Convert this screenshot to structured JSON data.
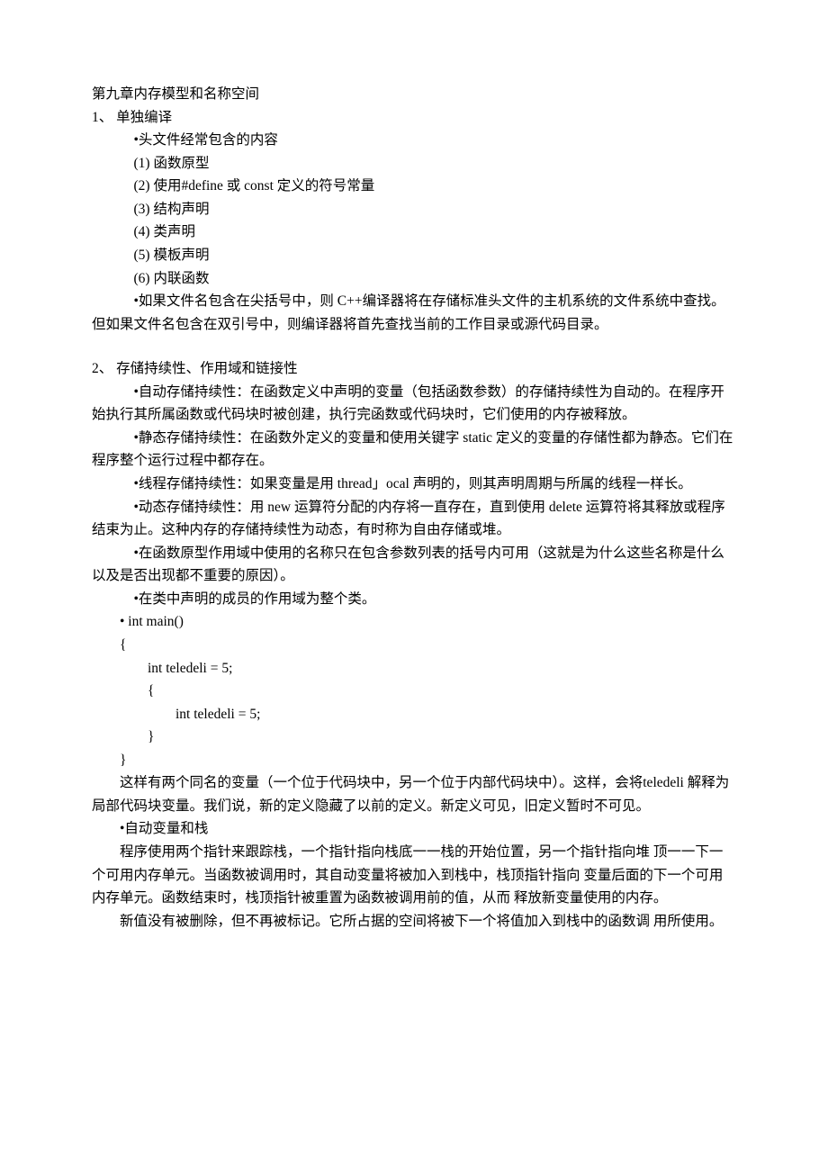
{
  "title": "第九章内存模型和名称空间",
  "sec1": {
    "num": "1、  单独编译",
    "b1": "•头文件经常包含的内容",
    "i1": "(1) 函数原型",
    "i2": "(2) 使用#define 或 const 定义的符号常量",
    "i3": "(3) 结构声明",
    "i4": "(4) 类声明",
    "i5": "(5) 模板声明",
    "i6": "(6) 内联函数",
    "p1": "•如果文件名包含在尖括号中，则 C++编译器将在存储标准头文件的主机系统的文件系统中查找。但如果文件名包含在双引号中，则编译器将首先查找当前的工作目录或源代码目录。"
  },
  "sec2": {
    "num": "2、  存储持续性、作用域和链接性",
    "p1": "•自动存储持续性：在函数定义中声明的变量（包括函数参数）的存储持续性为自动的。在程序开始执行其所属函数或代码块时被创建，执行完函数或代码块时，它们使用的内存被释放。",
    "p2": "•静态存储持续性：在函数外定义的变量和使用关键字 static 定义的变量的存储性都为静态。它们在程序整个运行过程中都存在。",
    "p3": "•线程存储持续性：如果变量是用 thread」ocal 声明的，则其声明周期与所属的线程一样长。",
    "p4": "•动态存储持续性：用 new 运算符分配的内存将一直存在，直到使用 delete 运算符将其释放或程序结束为止。这种内存的存储持续性为动态，有时称为自由存储或堆。",
    "p5": "•在函数原型作用域中使用的名称只在包含参数列表的括号内可用（这就是为什么这些名称是什么以及是否出现都不重要的原因）。",
    "p6": "•在类中声明的成员的作用域为整个类。",
    "code": {
      "l0": "•  int main()",
      "l1": "{",
      "l2": "int teledeli = 5;",
      "l3": "{",
      "l4": "int teledeli = 5;",
      "l5": "}",
      "l6": "}"
    },
    "p7": "这样有两个同名的变量（一个位于代码块中，另一个位于内部代码块中）。这样，会将teledeli 解释为局部代码块变量。我们说，新的定义隐藏了以前的定义。新定义可见，旧定义暂时不可见。",
    "p8": "•自动变量和栈",
    "p9": "程序使用两个指针来跟踪栈，一个指针指向栈底一一栈的开始位置，另一个指针指向堆  顶一一下一个可用内存单元。当函数被调用时，其自动变量将被加入到栈中，栈顶指针指向  变量后面的下一个可用内存单元。函数结束时，栈顶指针被重置为函数被调用前的值，从而  释放新变量使用的内存。",
    "p10": "新值没有被删除，但不再被标记。它所占据的空间将被下一个将值加入到栈中的函数调  用所使用。"
  }
}
